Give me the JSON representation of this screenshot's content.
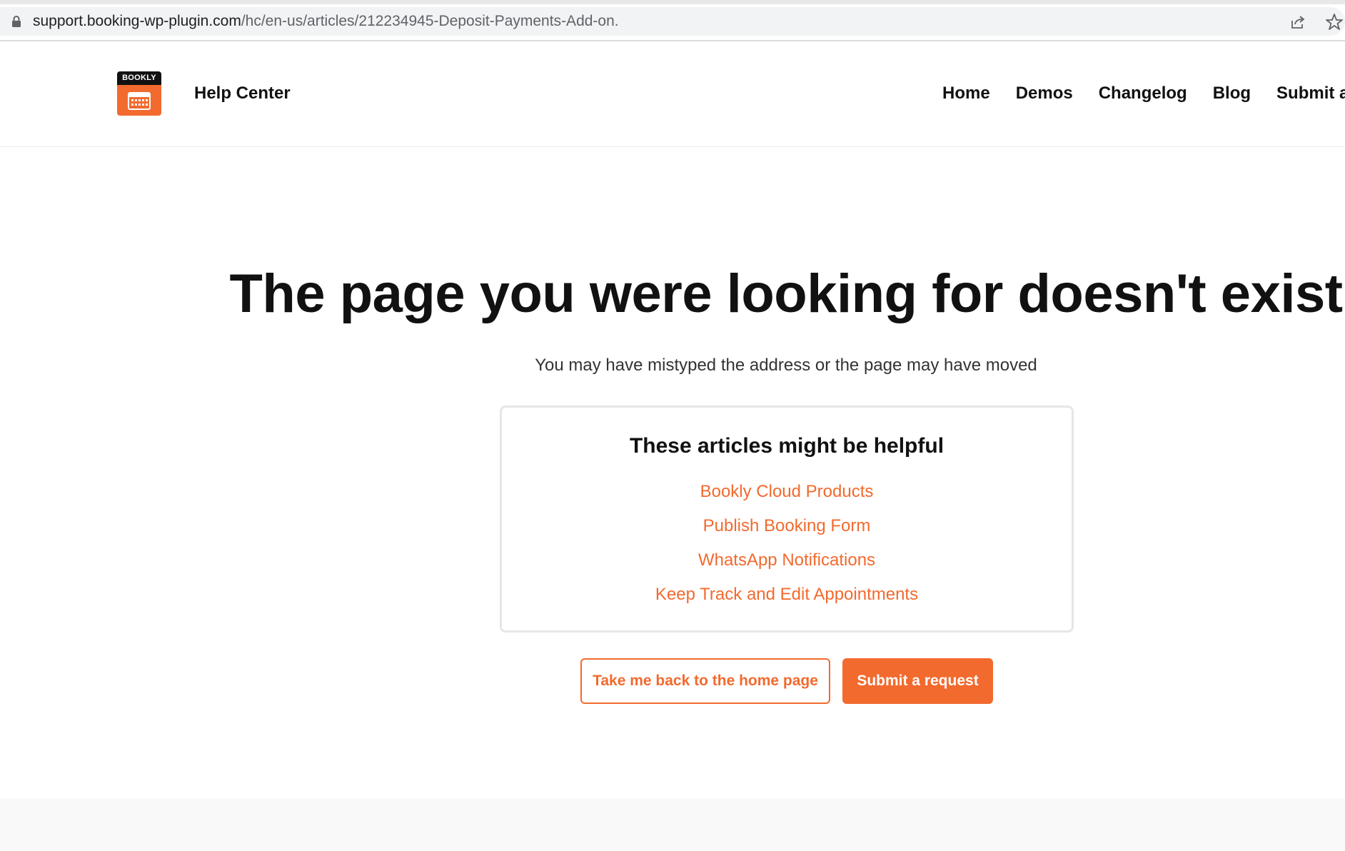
{
  "browser": {
    "url_domain": "support.booking-wp-plugin.com",
    "url_path": "/hc/en-us/articles/212234945-Deposit-Payments-Add-on."
  },
  "header": {
    "logo_text": "BOOKLY",
    "site_title": "Help Center",
    "nav": [
      "Home",
      "Demos",
      "Changelog",
      "Blog",
      "Submit a re"
    ]
  },
  "main": {
    "title": "The page you were looking for doesn't exist",
    "subtitle": "You may have mistyped the address or the page may have moved",
    "articles_heading": "These articles might be helpful",
    "articles": [
      "Bookly Cloud Products",
      "Publish Booking Form",
      "WhatsApp Notifications",
      "Keep Track and Edit Appointments"
    ],
    "home_button": "Take me back to the home page",
    "submit_button": "Submit a request"
  },
  "colors": {
    "accent": "#f26a2e",
    "text": "#111111"
  }
}
